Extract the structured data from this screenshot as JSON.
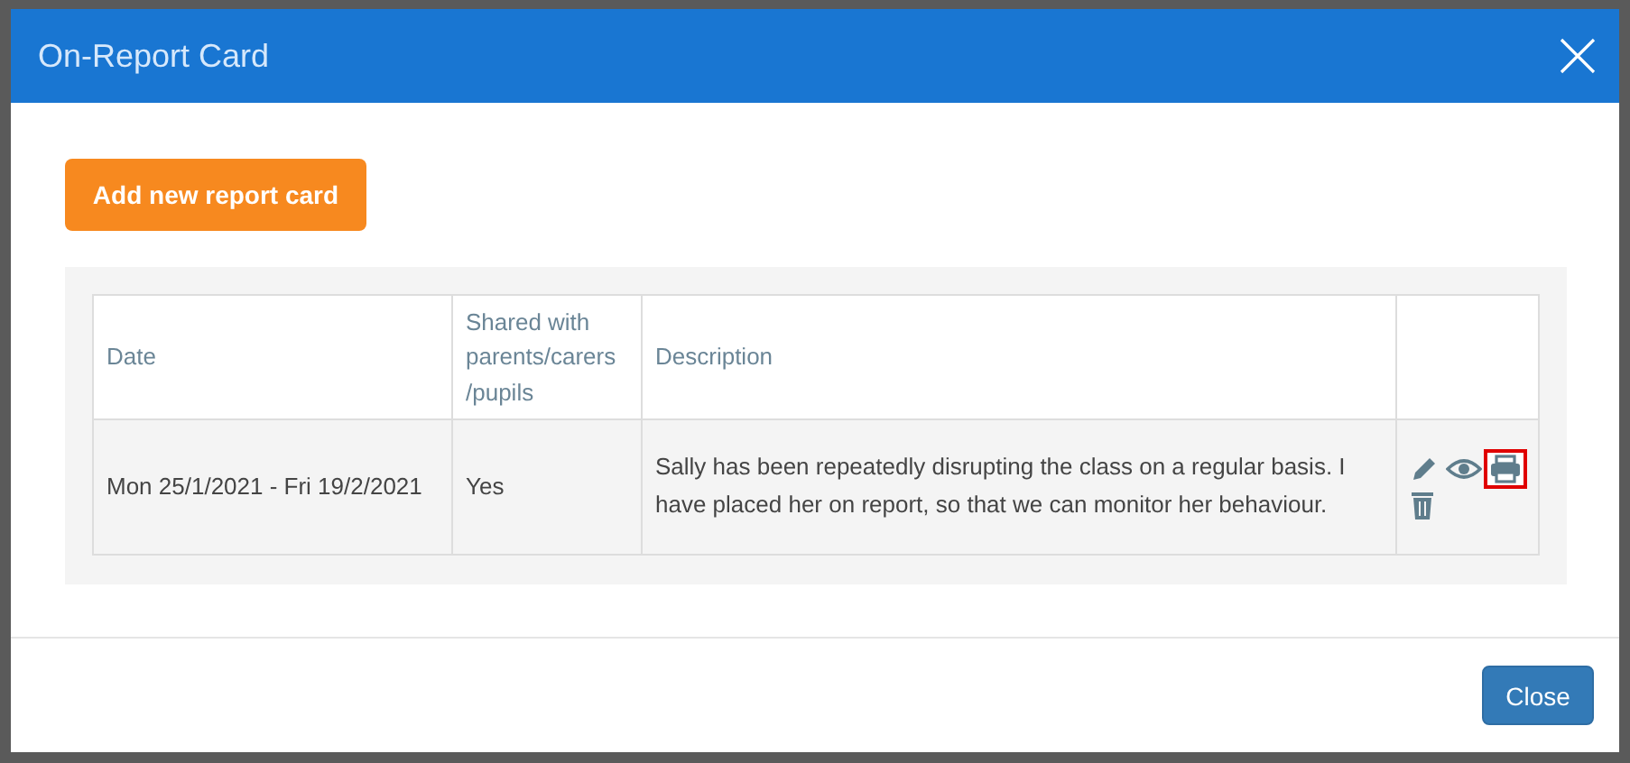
{
  "window": {
    "title": "On-Report Card"
  },
  "add_button": "Add new report card",
  "table": {
    "columns": [
      "Date",
      "Shared with parents/carers /pupils",
      "Description"
    ],
    "rows": [
      {
        "date": "Mon 25/1/2021 - Fri 19/2/2021",
        "shared": "Yes",
        "description": "Sally has been repeatedly disrupting the class on a regular basis. I have placed her on report, so that we can monitor her behaviour.",
        "actions": [
          {
            "kind": "edit",
            "highlighted": false
          },
          {
            "kind": "view",
            "highlighted": false
          },
          {
            "kind": "print",
            "highlighted": true
          },
          {
            "kind": "delete",
            "highlighted": false
          }
        ]
      }
    ]
  },
  "footer": {
    "close_button": "Close"
  }
}
